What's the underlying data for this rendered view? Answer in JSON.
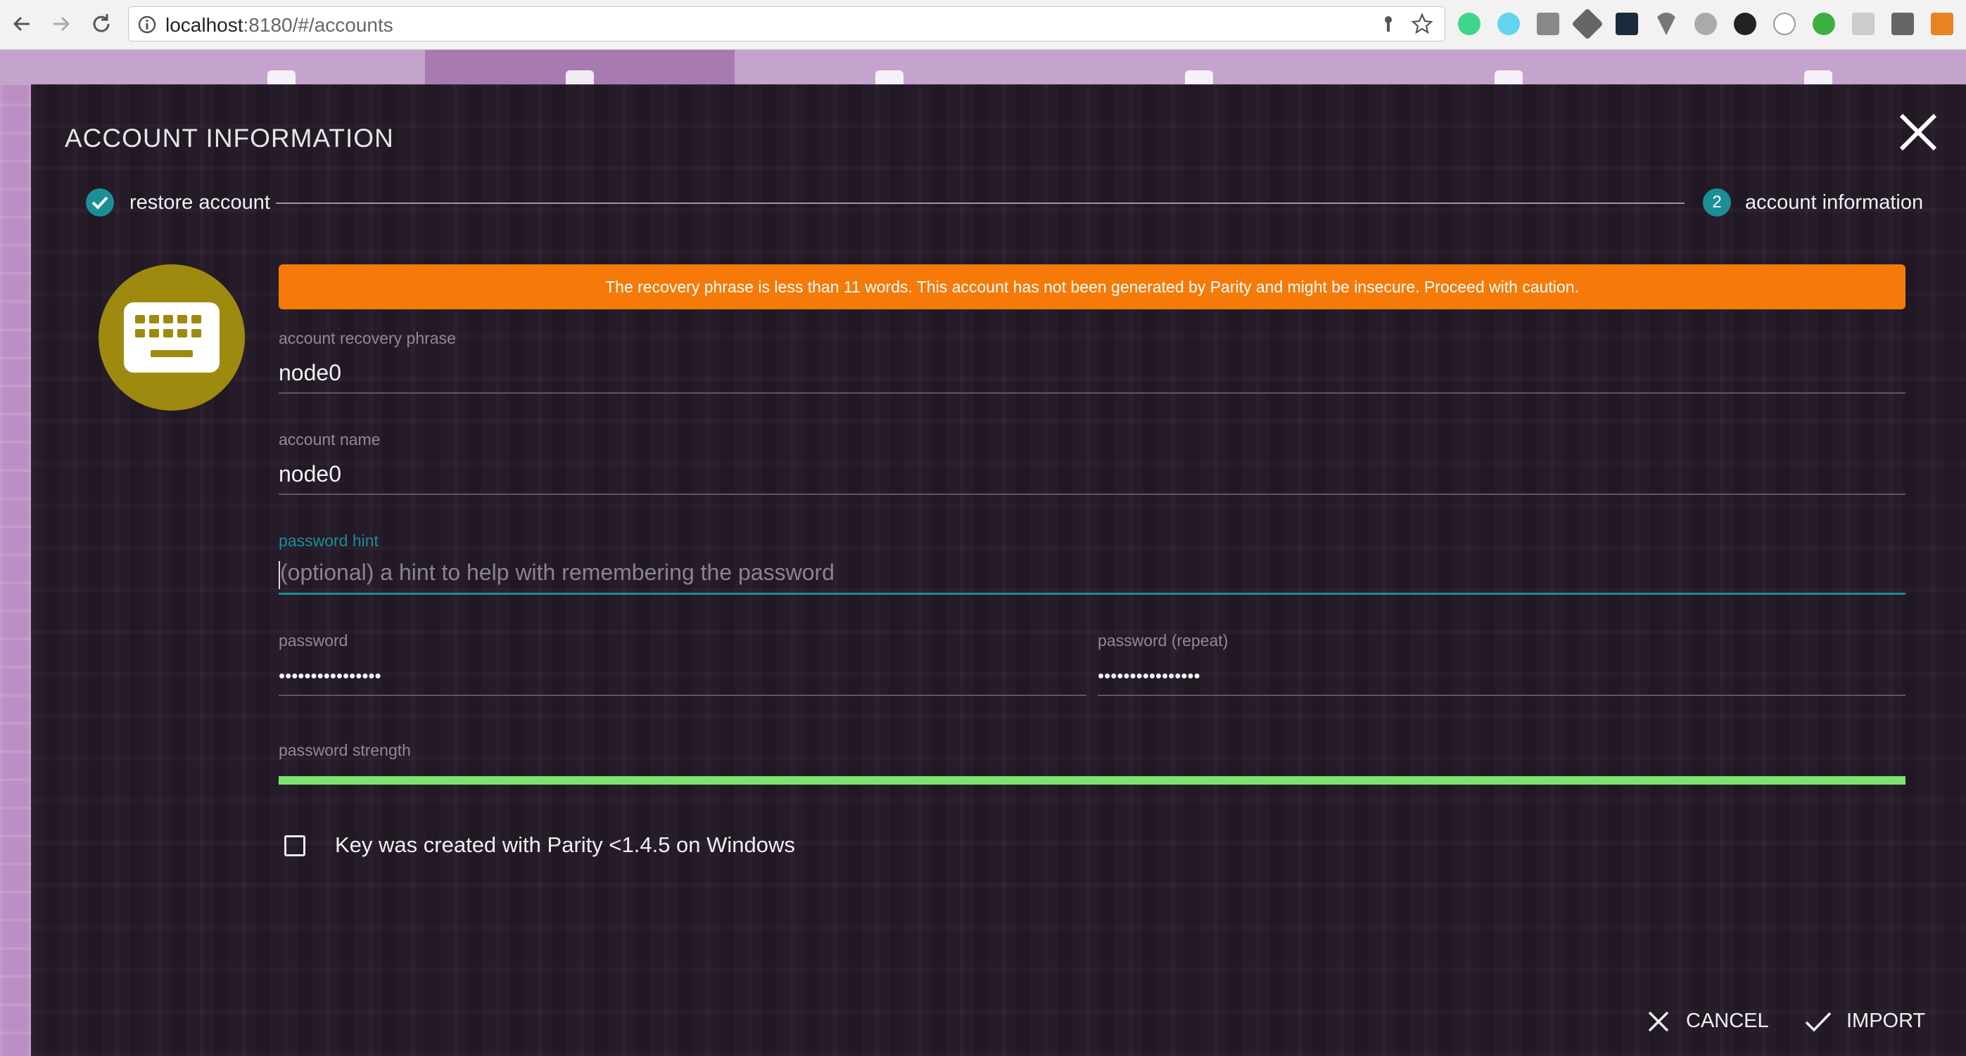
{
  "browser": {
    "url_host": "localhost",
    "url_rest": ":8180/#/accounts"
  },
  "modal": {
    "title": "ACCOUNT INFORMATION",
    "steps": [
      {
        "label": "restore account",
        "state": "complete"
      },
      {
        "label": "account information",
        "number": "2",
        "state": "active"
      }
    ],
    "warning": "The recovery phrase is less than 11 words. This account has not been generated by Parity and might be insecure. Proceed with caution.",
    "fields": {
      "recovery_phrase": {
        "label": "account recovery phrase",
        "value": "node0"
      },
      "account_name": {
        "label": "account name",
        "value": "node0"
      },
      "password_hint": {
        "label": "password hint",
        "value": "",
        "placeholder": "(optional) a hint to help with remembering the password"
      },
      "password": {
        "label": "password",
        "value": "••••••••••••••••"
      },
      "password_repeat": {
        "label": "password (repeat)",
        "value": "••••••••••••••••"
      },
      "password_strength": {
        "label": "password strength",
        "level": 1.0
      }
    },
    "checkbox": {
      "label": "Key was created with Parity <1.4.5 on Windows",
      "checked": false
    },
    "actions": {
      "cancel": "CANCEL",
      "import": "IMPORT"
    }
  },
  "colors": {
    "accent": "#1a8f98",
    "warning": "#f57a0a",
    "strength": "#7ee46f",
    "avatar": "#9e8a0f"
  }
}
